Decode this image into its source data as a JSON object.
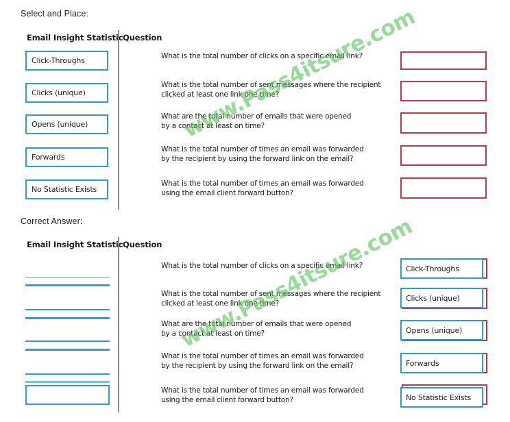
{
  "page": {
    "watermark": "www.Pass4itsure.com"
  },
  "sections": [
    {
      "label": "Select and Place:",
      "headers": {
        "left": "Email Insight Statistic",
        "right": "Question"
      }
    },
    {
      "label": "Correct Answer:",
      "headers": {
        "left": "Email Insight Statistic",
        "right": "Question"
      }
    }
  ],
  "statistics": [
    "Click-Throughs",
    "Clicks (unique)",
    "Opens (unique)",
    "Forwards",
    "No Statistic Exists"
  ],
  "questions": [
    "What is the total number of clicks on a specific email link?",
    "What is the total number of sent messages where the recipient\nclicked at least one link one  time?",
    "What are the total number of emails that were opened\nby a contact at least on time?",
    "What is the total number of times an email was forwarded\nby the recipient by using the  forward link on the email?",
    "What is the total number of times an email was forwarded\nusing the email client forward  button?"
  ],
  "answers": [
    "Click-Throughs",
    "Clicks (unique)",
    "Opens (unique)",
    "Forwards",
    "No Statistic Exists"
  ],
  "colors": {
    "tile_border": "#2e9cce",
    "drop_border": "#c0394b",
    "divider": "#8e8e8e",
    "watermark": "#5cc45c",
    "text": "#1c1c1c"
  }
}
